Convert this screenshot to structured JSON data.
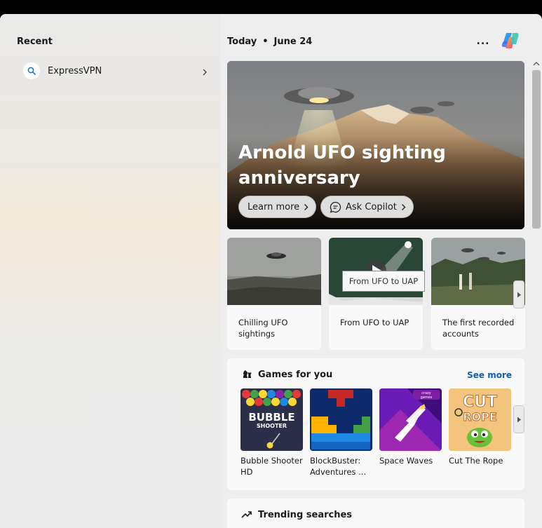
{
  "recent": {
    "title": "Recent",
    "items": [
      {
        "label": "ExpressVPN",
        "icon": "search-icon"
      }
    ]
  },
  "header": {
    "today": "Today",
    "date": "June 24",
    "more": "..."
  },
  "hero": {
    "title": "Arnold UFO sighting anniversary",
    "learn_more": "Learn more",
    "ask_copilot": "Ask Copilot"
  },
  "cards": [
    {
      "label": "Chilling UFO sightings"
    },
    {
      "label": "From UFO to UAP"
    },
    {
      "label": "The first recorded accounts"
    }
  ],
  "tooltip": "From UFO to UAP",
  "games": {
    "title": "Games for you",
    "see_more": "See more",
    "items": [
      {
        "label": "Bubble Shooter HD",
        "art_text": "BUBBLE SHOOTER"
      },
      {
        "label": "BlockBuster: Adventures ..."
      },
      {
        "label": "Space Waves",
        "badge": "crazy games"
      },
      {
        "label": "Cut The Rope",
        "art_text": "CUT the ROPE"
      }
    ]
  },
  "trending": {
    "title": "Trending searches"
  },
  "colors": {
    "accent_link": "#0c5fb6",
    "panel_bg": "#eeeeee",
    "card_bg": "#f9f9f9"
  }
}
